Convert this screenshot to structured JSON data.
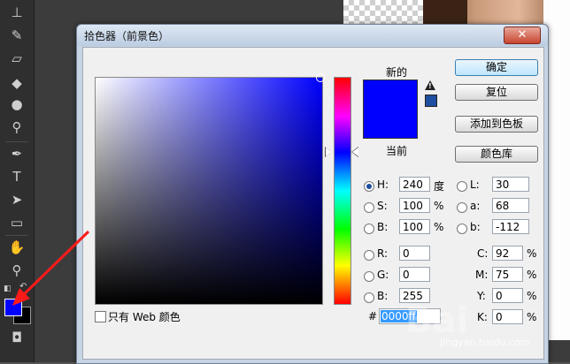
{
  "dialog": {
    "title": "拾色器（前景色）",
    "close_symbol": "✕",
    "new_label": "新的",
    "current_label": "当前",
    "buttons": {
      "ok": "确定",
      "reset": "复位",
      "add_to_swatches": "添加到色板",
      "color_libraries": "颜色库"
    },
    "fields": {
      "H": {
        "label": "H:",
        "value": "240",
        "unit": "度"
      },
      "S": {
        "label": "S:",
        "value": "100",
        "unit": "%"
      },
      "B": {
        "label": "B:",
        "value": "100",
        "unit": "%"
      },
      "R": {
        "label": "R:",
        "value": "0"
      },
      "G": {
        "label": "G:",
        "value": "0"
      },
      "Bl": {
        "label": "B:",
        "value": "255"
      },
      "L": {
        "label": "L:",
        "value": "30"
      },
      "a": {
        "label": "a:",
        "value": "68"
      },
      "b": {
        "label": "b:",
        "value": "-112"
      },
      "C": {
        "label": "C:",
        "value": "92",
        "unit": "%"
      },
      "M": {
        "label": "M:",
        "value": "75",
        "unit": "%"
      },
      "Y": {
        "label": "Y:",
        "value": "0",
        "unit": "%"
      },
      "K": {
        "label": "K:",
        "value": "0",
        "unit": "%"
      }
    },
    "hex_label": "#",
    "hex_value": "0000ff",
    "web_only_label": "只有 Web 颜色",
    "selected_mode": "H"
  },
  "colors": {
    "selected": "#0000ff",
    "gamut_warning_swatch": "#1f4fa0"
  },
  "toolbar": {
    "icons": [
      "stamp-icon",
      "history-brush-icon",
      "eraser-icon",
      "paint-bucket-icon",
      "blur-icon",
      "dodge-icon",
      "pen-icon",
      "type-icon",
      "path-select-icon",
      "rectangle-icon",
      "hand-icon",
      "zoom-icon"
    ]
  },
  "watermark": "jingyan.baidu.com"
}
